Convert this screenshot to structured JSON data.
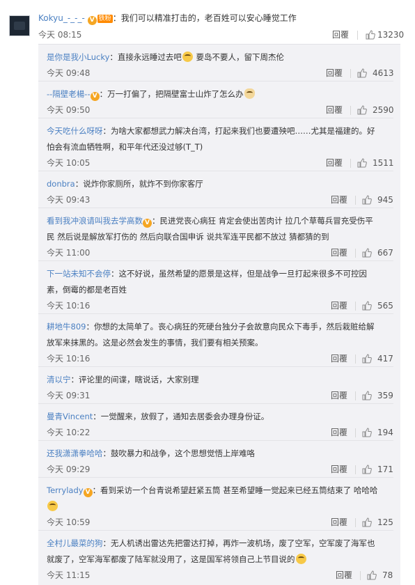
{
  "top_comment": {
    "user": "Kokyu_-_-_-",
    "badge_tag": "铁粉",
    "text": "：我们可以精准打击的，老百姓可以安心睡觉工作",
    "time": "今天 08:15",
    "reply_label": "回覆",
    "likes": "13230"
  },
  "replies": [
    {
      "user": "是你是我小Lucky",
      "text": "：直接永远睡过去吧",
      "emoji_after": "grin-emoji",
      "text2": " 要岛不要人，留下周杰伦",
      "time": "今天 09:48",
      "likes": "4613"
    },
    {
      "user": "--隔壁老楊--",
      "badge": "vip",
      "text": "：万一打偏了，把隔壁富士山炸了怎么办",
      "emoji_after": "cat-emoji",
      "time": "今天 09:50",
      "likes": "2590"
    },
    {
      "user": "今天吃什么呀呀",
      "text": "：为啥大家都想武力解决台湾，打起来我们也要遭殃吧……尤其是福建的。好",
      "line2": "怕会有流血牺牲啊，和平年代还没过够(T_T)",
      "time": "今天 10:05",
      "likes": "1511"
    },
    {
      "user": "donbra",
      "text": "：说炸你家厕所，就炸不到你家客厅",
      "time": "今天 09:43",
      "likes": "945"
    },
    {
      "user": "看到我冲浪请叫我去学高数",
      "badge": "vip",
      "text": "：民进党丧心病狂 肯定会使出苦肉计 拉几个草莓兵冒充受伤平",
      "line2": "民 然后说是解放军打伤的 然后向联合国申诉 说共军连平民都不放过 猜都猜的到",
      "time": "今天 11:00",
      "likes": "667"
    },
    {
      "user": "下一站未知不会停",
      "text": "：这不好说，虽然希望的愿景是这样，但是战争一旦打起来很多不可控因",
      "line2": "素，倒霉的都是老百姓",
      "time": "今天 10:16",
      "likes": "565"
    },
    {
      "user": "耕地牛809",
      "text": "：你想的太简单了。丧心病狂的死硬台独分子会故意向民众下毒手，然后栽赃给解",
      "line2": "放军来抹黑的。这是必然会发生的事情，我们要有相关预案。",
      "time": "今天 10:16",
      "likes": "417"
    },
    {
      "user": "清以宁",
      "text": "：评论里的间谍，瞎说话，大家别理",
      "time": "今天 09:31",
      "likes": "359"
    },
    {
      "user": "曼青Vincent",
      "text": "：一觉醒来，放假了，通知去居委会办理身份证。",
      "time": "今天 10:22",
      "likes": "194"
    },
    {
      "user": "还我潇潇拳哈哈",
      "text": "：鼓吹暴力和战争，这个思想觉悟上岸难咯",
      "time": "今天 09:29",
      "likes": "171"
    },
    {
      "user": "Terrylady",
      "badge": "vip",
      "text": "：看到采访一个台青说希望赶紧五筒 甚至希望睡一觉起来已经五筒结束了 哈哈哈",
      "line2_emoji": "laugh-emoji",
      "time": "今天 10:59",
      "likes": "125"
    },
    {
      "user": "全村儿最菜的狗",
      "text": "：无人机诱出雷达先把雷达打掉，再炸一波机场，废了空军，空军废了海军也",
      "line2": "就废了，空军海军都废了陆军就没用了，这是国军将领自己上节目说的",
      "line2_emoji_end": "laugh-emoji",
      "time": "今天 11:15",
      "likes": "78"
    }
  ],
  "reply_label": "回覆",
  "colors": {
    "name": "#4b80c2",
    "panel_bg": "#f2f2f5",
    "badge": "#ff8a00"
  }
}
